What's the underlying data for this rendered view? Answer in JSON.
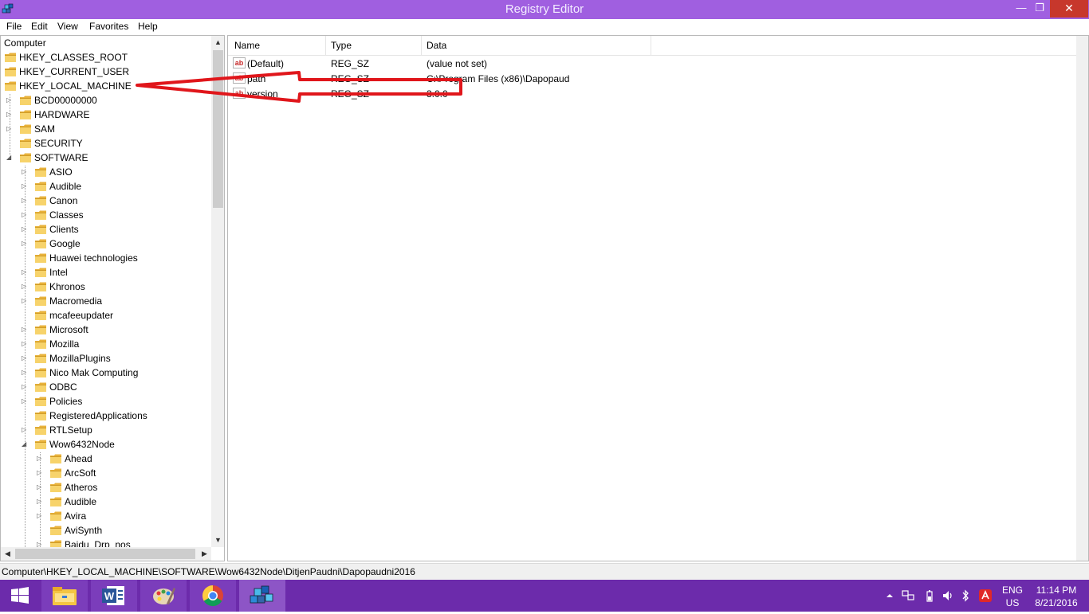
{
  "window": {
    "title": "Registry Editor",
    "controls": {
      "minimize": "—",
      "maximize": "❐",
      "close": "✕"
    }
  },
  "menu": [
    "File",
    "Edit",
    "View",
    "Favorites",
    "Help"
  ],
  "tree": {
    "root": "Computer",
    "top_keys": [
      "HKEY_CLASSES_ROOT",
      "HKEY_CURRENT_USER",
      "HKEY_LOCAL_MACHINE"
    ],
    "hklm_children": [
      "BCD00000000",
      "HARDWARE",
      "SAM",
      "SECURITY",
      "SOFTWARE"
    ],
    "software_children": [
      "ASIO",
      "Audible",
      "Canon",
      "Classes",
      "Clients",
      "Google",
      "Huawei technologies",
      "Intel",
      "Khronos",
      "Macromedia",
      "mcafeeupdater",
      "Microsoft",
      "Mozilla",
      "MozillaPlugins",
      "Nico Mak Computing",
      "ODBC",
      "Policies",
      "RegisteredApplications",
      "RTLSetup",
      "Wow6432Node"
    ],
    "wow_children": [
      "Ahead",
      "ArcSoft",
      "Atheros",
      "Audible",
      "Avira",
      "AviSynth",
      "Baidu_Drp_nos"
    ]
  },
  "list": {
    "columns": [
      "Name",
      "Type",
      "Data"
    ],
    "rows": [
      {
        "name": "(Default)",
        "type": "REG_SZ",
        "data": "(value not set)"
      },
      {
        "name": "path",
        "type": "REG_SZ",
        "data": "C:\\Program Files (x86)\\Dapopaud"
      },
      {
        "name": "version",
        "type": "REG_SZ",
        "data": "3.0.0"
      }
    ]
  },
  "status": "Computer\\HKEY_LOCAL_MACHINE\\SOFTWARE\\Wow6432Node\\DitjenPaudni\\Dapopaudni2016",
  "taskbar": {
    "apps": [
      "windows-start",
      "file-explorer",
      "word",
      "paint",
      "chrome",
      "registry-editor"
    ],
    "lang_line1": "ENG",
    "lang_line2": "US",
    "time": "11:14 PM",
    "date": "8/21/2016"
  },
  "colors": {
    "titlebar": "#a05fe0",
    "taskbar": "#6c2bab",
    "annotation": "#e0161b"
  }
}
